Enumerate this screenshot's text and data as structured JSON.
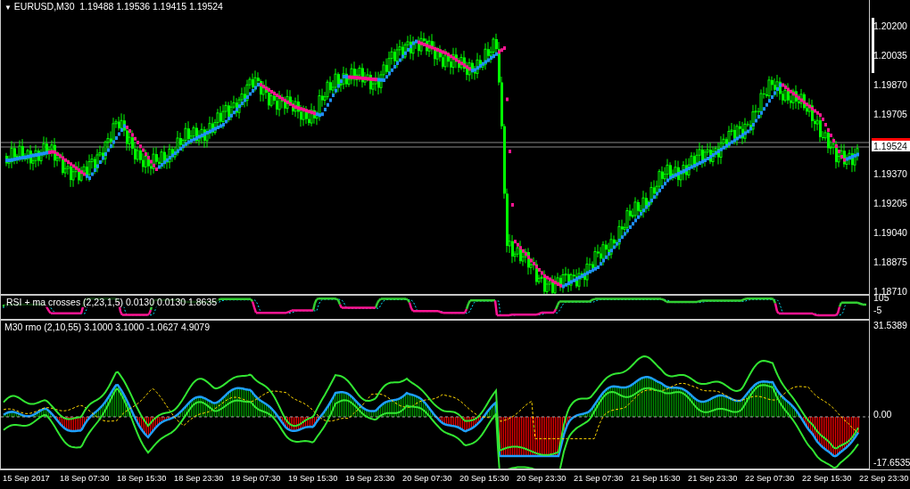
{
  "chart": {
    "menu_glyph": "▼",
    "symbol": "EURUSD,M30",
    "ohlc": [
      "1.19488",
      "1.19536",
      "1.19415",
      "1.19524"
    ],
    "price_ticks": [
      "1.20200",
      "1.20035",
      "1.19870",
      "1.19705",
      "1.19370",
      "1.19205",
      "1.19040",
      "1.18875",
      "1.18710"
    ],
    "current_price": "1.19524"
  },
  "rsi_panel": {
    "title": "RSI + ma crosses (2,23,1,5) 0.0130 0.0130 1.8635",
    "scale": [
      "105",
      "-5"
    ]
  },
  "rmo_panel": {
    "title": "M30 rmo (2,10,55) 3.1000 3.1000 -1.0627 4.9079",
    "scale": [
      "31.5389",
      "0.00",
      "-17.6535"
    ]
  },
  "time_axis": [
    "15 Sep 2017",
    "18 Sep 07:30",
    "18 Sep 15:30",
    "18 Sep 23:30",
    "19 Sep 07:30",
    "19 Sep 15:30",
    "19 Sep 23:30",
    "20 Sep 07:30",
    "20 Sep 15:30",
    "20 Sep 23:30",
    "21 Sep 07:30",
    "21 Sep 15:30",
    "21 Sep 23:30",
    "22 Sep 07:30",
    "22 Sep 15:30",
    "22 Sep 23:30"
  ]
}
